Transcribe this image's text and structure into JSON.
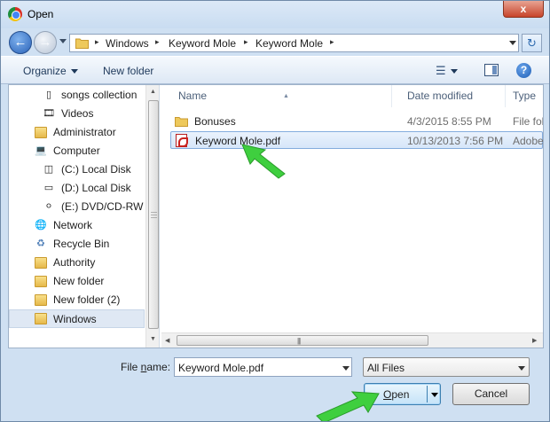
{
  "window": {
    "title": "Open",
    "close_glyph": "x"
  },
  "address": {
    "crumbs": [
      "Windows",
      "Keyword Mole",
      "Keyword Mole"
    ],
    "separator": "▸"
  },
  "toolbar": {
    "organize_label": "Organize",
    "new_folder_label": "New folder"
  },
  "navigation": {
    "items": [
      {
        "label": "songs collection",
        "icon": "folder-icon"
      },
      {
        "label": "Videos",
        "icon": "videos-icon"
      },
      {
        "label": "Administrator",
        "icon": "user-icon"
      },
      {
        "label": "Computer",
        "icon": "computer-icon"
      },
      {
        "label": "(C:) Local Disk",
        "icon": "windows-drive-icon"
      },
      {
        "label": "(D:) Local Disk",
        "icon": "drive-icon"
      },
      {
        "label": "(E:) DVD/CD-RW D",
        "icon": "dvd-drive-icon"
      },
      {
        "label": "Network",
        "icon": "network-icon"
      },
      {
        "label": "Recycle Bin",
        "icon": "recycle-bin-icon"
      },
      {
        "label": "Authority",
        "icon": "folder-icon"
      },
      {
        "label": "New folder",
        "icon": "folder-icon"
      },
      {
        "label": "New folder (2)",
        "icon": "folder-icon"
      },
      {
        "label": "Windows",
        "icon": "folder-icon"
      }
    ],
    "selected": "Windows"
  },
  "files": {
    "columns": [
      "Name",
      "Date modified",
      "Type"
    ],
    "rows": [
      {
        "name": "Bonuses",
        "date": "4/3/2015 8:55 PM",
        "type": "File fol",
        "icon": "folder-icon"
      },
      {
        "name": "Keyword Mole.pdf",
        "date": "10/13/2013 7:56 PM",
        "type": "Adobe",
        "icon": "pdf-icon"
      }
    ],
    "selected_index": 1
  },
  "footer": {
    "file_name_label_prefix": "File ",
    "file_name_label_accel": "n",
    "file_name_label_suffix": "ame:",
    "file_name_value": "Keyword Mole.pdf",
    "file_type_value": "All Files",
    "open_label_accel": "O",
    "open_label_rest": "pen",
    "cancel_label": "Cancel"
  },
  "colors": {
    "annotation_arrow": "#3fcf3f",
    "selection": "#d6e6f9",
    "accent": "#2a62b8"
  }
}
